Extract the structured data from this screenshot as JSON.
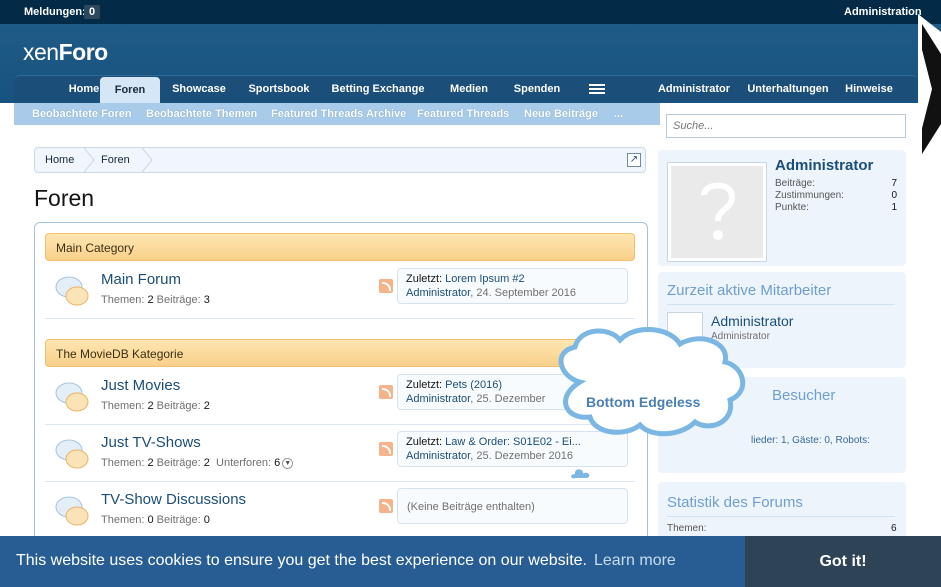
{
  "topbar": {
    "notifications_label": "Meldungen:",
    "notifications_count": "0",
    "account": "Administration"
  },
  "logo": {
    "part1": "xen",
    "part2": "Foro"
  },
  "nav": {
    "tabs": [
      "Home",
      "Foren",
      "Showcase",
      "Sportsbook",
      "Betting Exchange",
      "Medien",
      "Spenden"
    ],
    "active": "Foren",
    "right": [
      "Administrator",
      "Unterhaltungen",
      "Hinweise"
    ]
  },
  "subnav": [
    "Beobachtete Foren",
    "Beobachtete Themen",
    "Featured Threads Archive",
    "Featured Threads",
    "Neue Beiträge",
    "..."
  ],
  "search": {
    "placeholder": "Suche..."
  },
  "breadcrumb": [
    "Home",
    "Foren"
  ],
  "page_title": "Foren",
  "categories": [
    {
      "title": "Main Category"
    },
    {
      "title": "The MovieDB Kategorie"
    }
  ],
  "forums": [
    {
      "name": "Main Forum",
      "themen_label": "Themen:",
      "themen": "2",
      "beitraege_label": "Beiträge:",
      "beitraege": "3",
      "last_label": "Zuletzt:",
      "last_title": "Lorem Ipsum #2",
      "last_user": "Administrator",
      "last_date": "24. September 2016"
    },
    {
      "name": "Just Movies",
      "themen_label": "Themen:",
      "themen": "2",
      "beitraege_label": "Beiträge:",
      "beitraege": "2",
      "last_label": "Zuletzt:",
      "last_title": "Pets (2016)",
      "last_user": "Administrator",
      "last_date": "25. Dezember"
    },
    {
      "name": "Just TV-Shows",
      "themen_label": "Themen:",
      "themen": "2",
      "beitraege_label": "Beiträge:",
      "beitraege": "2",
      "unterforen_label": "Unterforen:",
      "unterforen": "6",
      "last_label": "Zuletzt:",
      "last_title": "Law & Order: S01E02 - Ei...",
      "last_user": "Administrator",
      "last_date": "25. Dezember 2016"
    },
    {
      "name": "TV-Show Discussions",
      "themen_label": "Themen:",
      "themen": "0",
      "beitraege_label": "Beiträge:",
      "beitraege": "0",
      "empty": "(Keine Beiträge enthalten)"
    }
  ],
  "sidebar": {
    "user": {
      "name": "Administrator",
      "stats": [
        {
          "label": "Beiträge:",
          "value": "7"
        },
        {
          "label": "Zustimmungen:",
          "value": "0"
        },
        {
          "label": "Punkte:",
          "value": "1"
        }
      ]
    },
    "staff": {
      "title": "Zurzeit aktive Mitarbeiter",
      "name": "Administrator",
      "role": "Administrator"
    },
    "visitors": {
      "title": "Besucher",
      "line": "lieder: 1, Gäste: 0, Robots:"
    },
    "stats": {
      "title": "Statistik des Forums",
      "label": "Themen:",
      "value": "6"
    }
  },
  "cloud": {
    "text": "Bottom Edgeless"
  },
  "cookie": {
    "message": "This website uses cookies to ensure you get the best experience on our website.",
    "learn_more": "Learn more",
    "button": "Got it!"
  },
  "colors": {
    "header": "#1f5b86",
    "topbar": "#032a46",
    "cookie": "#275d93",
    "accent": "#6f9fcd"
  }
}
